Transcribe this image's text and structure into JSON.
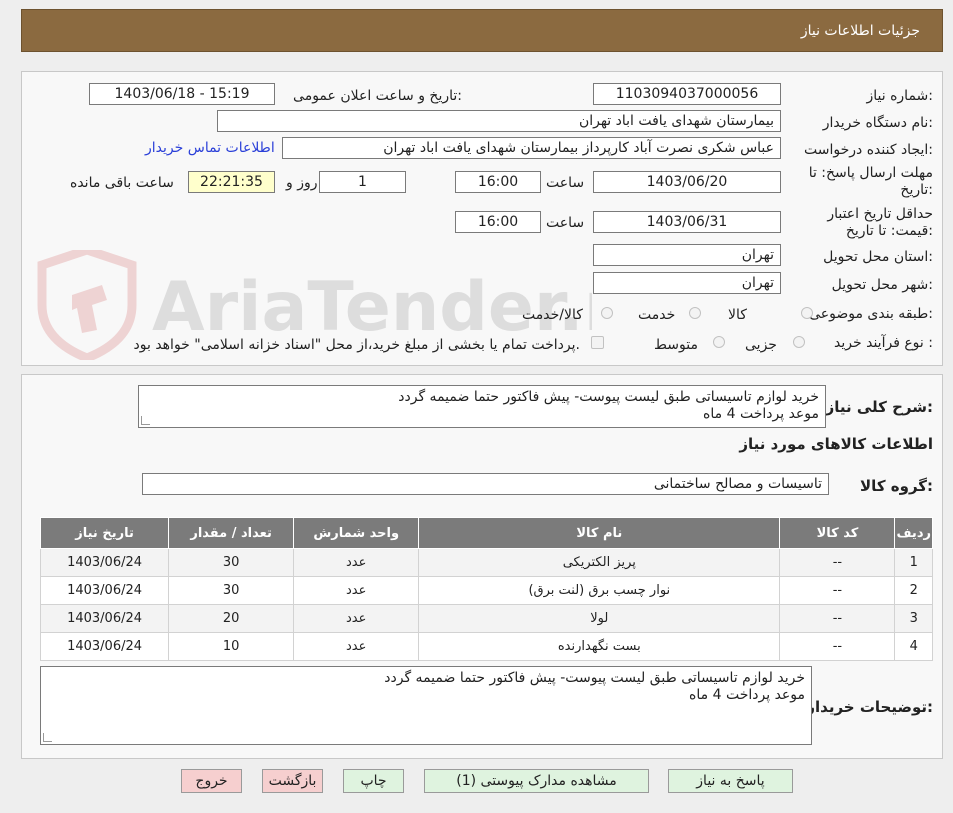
{
  "header": {
    "title": "جزئیات اطلاعات نیاز"
  },
  "form": {
    "need_number_label": "شماره نیاز:",
    "need_number": "1103094037000056",
    "announce_label": "تاریخ و ساعت اعلان عمومی:",
    "announce_value": "1403/06/18 - 15:19",
    "buyer_label": "نام دستگاه خریدار:",
    "buyer_value": "بیمارستان شهدای یافت اباد تهران",
    "requester_label": "ایجاد کننده درخواست:",
    "requester_value": "عباس شکری نصرت آباد کارپرداز  بیمارستان شهدای یافت اباد تهران",
    "contact_link": "اطلاعات تماس خریدار",
    "deadline_label_1": "مهلت ارسال پاسخ: تا",
    "deadline_label_2": "تاریخ:",
    "deadline_date": "1403/06/20",
    "time_label": "ساعت",
    "deadline_time": "16:00",
    "days_value": "1",
    "days_label": "روز و",
    "remaining_time": "22:21:35",
    "remaining_label": "ساعت باقی مانده",
    "validity_label_1": "حداقل تاریخ اعتبار",
    "validity_label_2": "قیمت: تا تاریخ:",
    "validity_date": "1403/06/31",
    "validity_time": "16:00",
    "province_label": "استان محل تحویل:",
    "province_value": "تهران",
    "city_label": "شهر محل تحویل:",
    "city_value": "تهران",
    "category_label": "طبقه بندی موضوعی:",
    "category_options": [
      "کالا",
      "خدمت",
      "کالا/خدمت"
    ],
    "process_label": "نوع فرآیند خرید :",
    "process_options": [
      "جزیی",
      "متوسط"
    ],
    "payment_note": "پرداخت تمام یا بخشی از مبلغ خرید،از محل \"اسناد خزانه اسلامی\" خواهد بود."
  },
  "summary": {
    "label": "شرح کلی نیاز:",
    "line1": "خرید لوازم تاسیساتی طبق لیست پیوست- پیش فاکتور حتما ضمیمه گردد",
    "line2": "موعد پرداخت 4 ماه"
  },
  "goods": {
    "title": "اطلاعات کالاهای مورد نیاز",
    "group_label": "گروه کالا:",
    "group_value": "تاسیسات و مصالح ساختمانی"
  },
  "table": {
    "headers": [
      "ردیف",
      "کد کالا",
      "نام کالا",
      "واحد شمارش",
      "تعداد / مقدار",
      "تاریخ نیاز"
    ],
    "rows": [
      [
        "1",
        "--",
        "پریز الکتریکی",
        "عدد",
        "30",
        "1403/06/24"
      ],
      [
        "2",
        "--",
        "نوار چسب برق (لنت برق)",
        "عدد",
        "30",
        "1403/06/24"
      ],
      [
        "3",
        "--",
        "لولا",
        "عدد",
        "20",
        "1403/06/24"
      ],
      [
        "4",
        "--",
        "بست نگهدارنده",
        "عدد",
        "10",
        "1403/06/24"
      ]
    ]
  },
  "buyer_notes": {
    "label": "توضیحات خریدار:",
    "line1": "خرید لوازم تاسیساتی طبق لیست پیوست- پیش فاکتور حتما ضمیمه گردد",
    "line2": "موعد پرداخت 4 ماه"
  },
  "buttons": {
    "reply": "پاسخ به نیاز",
    "attachments": "مشاهده مدارک پیوستی (1)",
    "print": "چاپ",
    "back": "بازگشت",
    "exit": "خروج"
  },
  "watermark": {
    "text": "AriaTender.neT"
  },
  "colors": {
    "header": "#8b6a40",
    "table_header": "#7b7b7b",
    "button": "#dff3df",
    "button_red": "#f6cfcf",
    "link": "#2a3fd8"
  }
}
